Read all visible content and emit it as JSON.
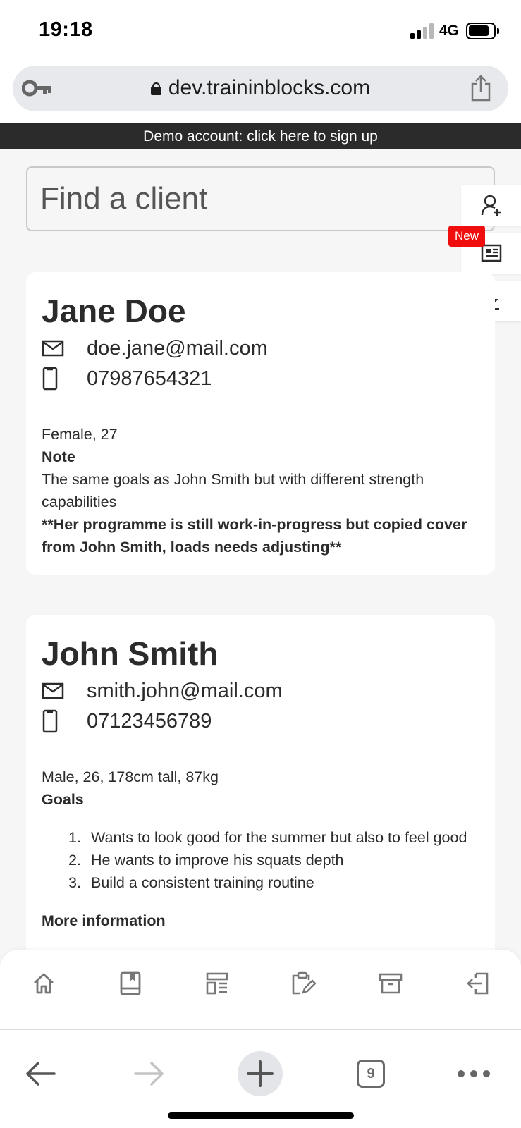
{
  "status_bar": {
    "time": "19:18",
    "network": "4G"
  },
  "browser": {
    "url": "dev.traininblocks.com",
    "tab_count": "9"
  },
  "banner": {
    "text": "Demo account: click here to sign up"
  },
  "search": {
    "placeholder": "Find a client"
  },
  "side_actions": {
    "new_badge": "New"
  },
  "clients": [
    {
      "name": "Jane Doe",
      "email": "doe.jane@mail.com",
      "phone": "07987654321",
      "details": "Female, 27",
      "note_heading": "Note",
      "note_text": "The same goals as John Smith but with different strength capabilities",
      "note_bold": "**Her programme is still work-in-progress but copied cover from John Smith, loads needs adjusting**"
    },
    {
      "name": "John Smith",
      "email": "smith.john@mail.com",
      "phone": "07123456789",
      "details": "Male, 26, 178cm tall, 87kg",
      "goals_heading": "Goals",
      "goals": [
        "Wants to look good for the summer but also to feel good",
        "He wants to improve his squats depth",
        "Build a consistent training routine"
      ],
      "goal_numbers": [
        "1.",
        "2.",
        "3."
      ],
      "more_heading": "More information"
    }
  ],
  "icons": {
    "status": [
      "signal-icon",
      "battery-icon"
    ],
    "app_nav": [
      "home-icon",
      "book-icon",
      "layout-icon",
      "clipboard-edit-icon",
      "archive-icon",
      "logout-icon"
    ],
    "side": [
      "add-client-icon",
      "news-icon",
      "download-icon"
    ],
    "browser": [
      "back-arrow-icon",
      "forward-arrow-icon",
      "plus-icon",
      "tabs-icon",
      "more-icon"
    ]
  },
  "colors": {
    "banner_bg": "#2b2b2b",
    "badge": "#f00d0d",
    "page_bg": "#f6f6f6"
  }
}
